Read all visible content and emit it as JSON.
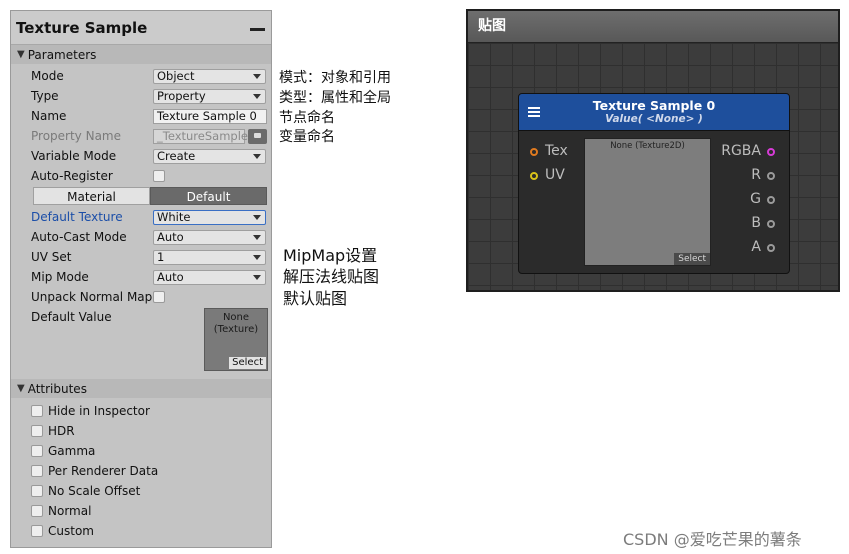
{
  "inspector": {
    "title": "Texture Sample",
    "parameters_header": "Parameters",
    "mode_label": "Mode",
    "mode_value": "Object",
    "type_label": "Type",
    "type_value": "Property",
    "name_label": "Name",
    "name_value": "Texture Sample 0",
    "property_name_label": "Property Name",
    "property_name_value": "_TextureSample",
    "variable_mode_label": "Variable Mode",
    "variable_mode_value": "Create",
    "auto_register_label": "Auto-Register",
    "tab_material": "Material",
    "tab_default": "Default",
    "default_texture_label": "Default Texture",
    "default_texture_value": "White",
    "auto_cast_label": "Auto-Cast Mode",
    "auto_cast_value": "Auto",
    "uv_set_label": "UV Set",
    "uv_set_value": "1",
    "mip_mode_label": "Mip Mode",
    "mip_mode_value": "Auto",
    "unpack_label": "Unpack Normal Map",
    "default_value_label": "Default Value",
    "thumb_text": "None\n(Texture)",
    "thumb_select": "Select",
    "attributes_header": "Attributes",
    "attributes": [
      "Hide in Inspector",
      "HDR",
      "Gamma",
      "Per Renderer Data",
      "No Scale Offset",
      "Normal",
      "Custom"
    ]
  },
  "annotations": {
    "lines_small": [
      "模式：对象和引用",
      "类型：属性和全局",
      "节点命名",
      "变量命名"
    ],
    "lines_big": [
      "MipMap设置",
      "解压法线贴图",
      "默认贴图"
    ]
  },
  "graph": {
    "title": "贴图",
    "node_title": "Texture Sample 0",
    "node_subtitle": "Value( <None> )",
    "inputs": [
      {
        "label": "Tex",
        "color": "#e07a1f"
      },
      {
        "label": "UV",
        "color": "#d9c21a"
      }
    ],
    "outputs": [
      {
        "label": "RGBA",
        "color": "#d63bd6"
      },
      {
        "label": "R",
        "color": "#9a9a9a"
      },
      {
        "label": "G",
        "color": "#9a9a9a"
      },
      {
        "label": "B",
        "color": "#9a9a9a"
      },
      {
        "label": "A",
        "color": "#9a9a9a"
      }
    ],
    "preview_text": "None (Texture2D)",
    "preview_select": "Select"
  },
  "watermark": "CSDN @爱吃芒果的薯条"
}
